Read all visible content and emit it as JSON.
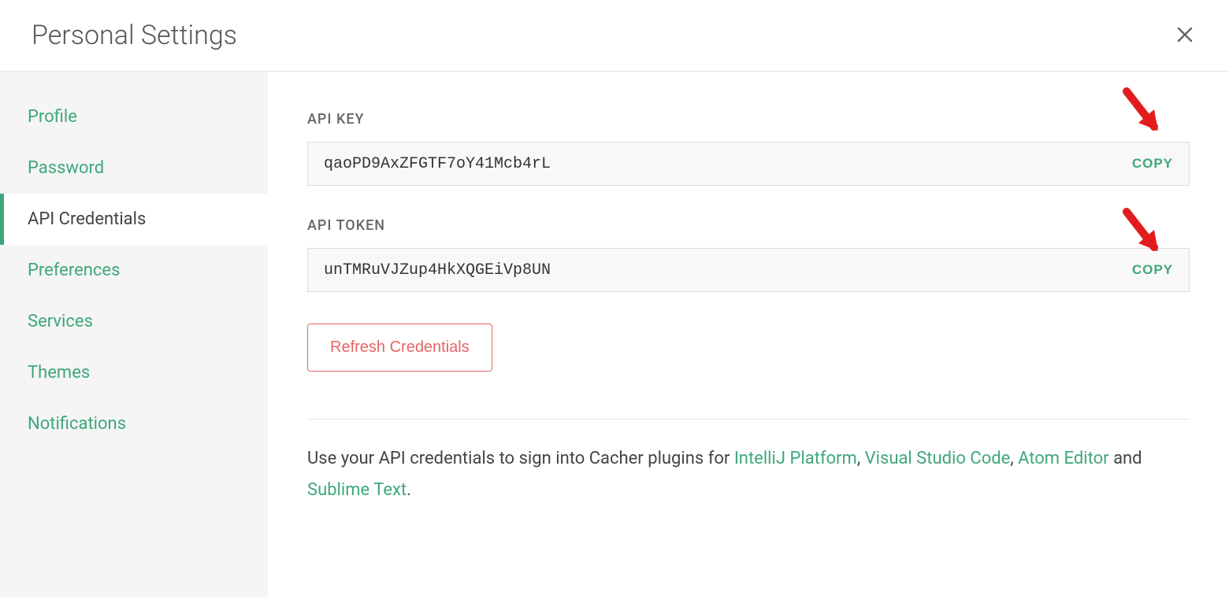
{
  "header": {
    "title": "Personal Settings"
  },
  "sidebar": {
    "items": [
      {
        "label": "Profile"
      },
      {
        "label": "Password"
      },
      {
        "label": "API Credentials"
      },
      {
        "label": "Preferences"
      },
      {
        "label": "Services"
      },
      {
        "label": "Themes"
      },
      {
        "label": "Notifications"
      }
    ]
  },
  "main": {
    "api_key": {
      "label": "API KEY",
      "value": "qaoPD9AxZFGTF7oY41Mcb4rL",
      "copy_label": "COPY"
    },
    "api_token": {
      "label": "API TOKEN",
      "value": "unTMRuVJZup4HkXQGEiVp8UN",
      "copy_label": "COPY"
    },
    "refresh_label": "Refresh Credentials",
    "help": {
      "prefix": "Use your API credentials to sign into Cacher plugins for ",
      "links": [
        "IntelliJ Platform",
        "Visual Studio Code",
        "Atom Editor",
        "Sublime Text"
      ],
      "sep1": ", ",
      "sep2": ", ",
      "sep3": " and ",
      "suffix": "."
    }
  }
}
